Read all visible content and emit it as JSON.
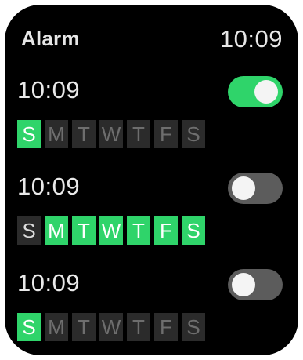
{
  "header": {
    "title": "Alarm",
    "clock": "10:09"
  },
  "colors": {
    "accent_green": "#2fd46a",
    "toggle_off": "#5c5c5c",
    "day_inactive_bg": "#2b2b2b"
  },
  "alarms": [
    {
      "time": "10:09",
      "enabled": true,
      "days": [
        {
          "label": "S",
          "active": true
        },
        {
          "label": "M",
          "active": false
        },
        {
          "label": "T",
          "active": false
        },
        {
          "label": "W",
          "active": false
        },
        {
          "label": "T",
          "active": false
        },
        {
          "label": "F",
          "active": false
        },
        {
          "label": "S",
          "active": false
        }
      ]
    },
    {
      "time": "10:09",
      "enabled": false,
      "days": [
        {
          "label": "S",
          "active": false
        },
        {
          "label": "M",
          "active": true
        },
        {
          "label": "T",
          "active": true
        },
        {
          "label": "W",
          "active": true
        },
        {
          "label": "T",
          "active": true
        },
        {
          "label": "F",
          "active": true
        },
        {
          "label": "S",
          "active": true
        }
      ]
    },
    {
      "time": "10:09",
      "enabled": false,
      "days": [
        {
          "label": "S",
          "active": true
        },
        {
          "label": "M",
          "active": false
        },
        {
          "label": "T",
          "active": false
        },
        {
          "label": "W",
          "active": false
        },
        {
          "label": "T",
          "active": false
        },
        {
          "label": "F",
          "active": false
        },
        {
          "label": "S",
          "active": false
        }
      ]
    }
  ]
}
